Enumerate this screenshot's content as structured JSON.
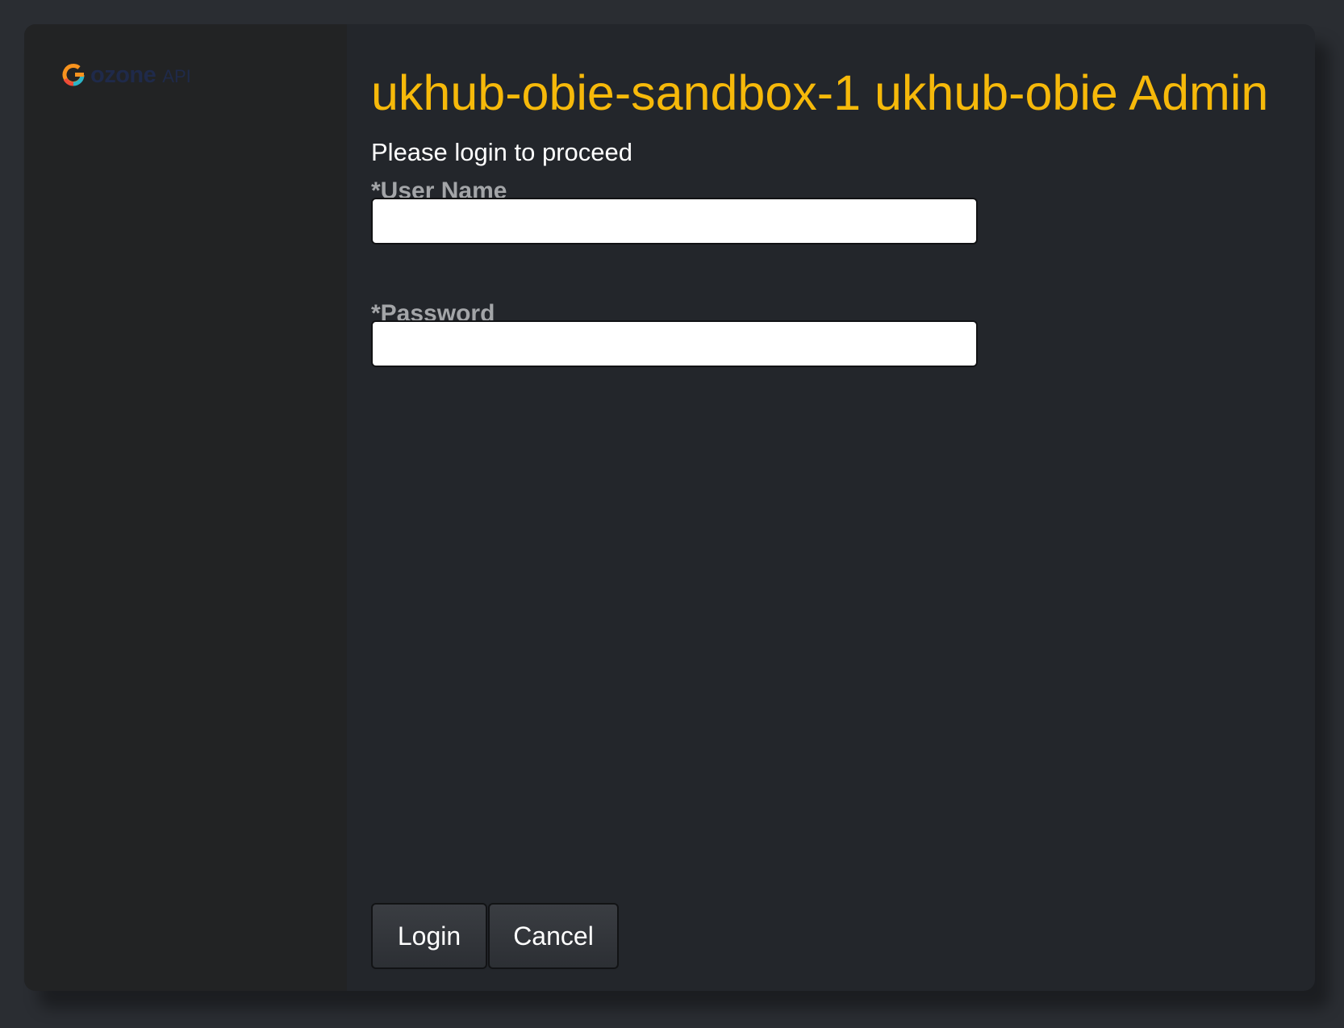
{
  "brand": {
    "logo_word": "ozone",
    "logo_suffix": "API",
    "logo_colors": [
      "#f7931e",
      "#ef4c37",
      "#2bb5c8"
    ],
    "text_color": "#1f2a4a"
  },
  "page": {
    "title": "ukhub-obie-sandbox-1 ukhub-obie Admin",
    "subtitle": "Please login to proceed",
    "title_color": "#f6b90a"
  },
  "form": {
    "username": {
      "label": "*User Name",
      "value": "",
      "placeholder": ""
    },
    "password": {
      "label": "*Password",
      "value": "",
      "placeholder": ""
    }
  },
  "actions": {
    "login_label": "Login",
    "cancel_label": "Cancel"
  }
}
